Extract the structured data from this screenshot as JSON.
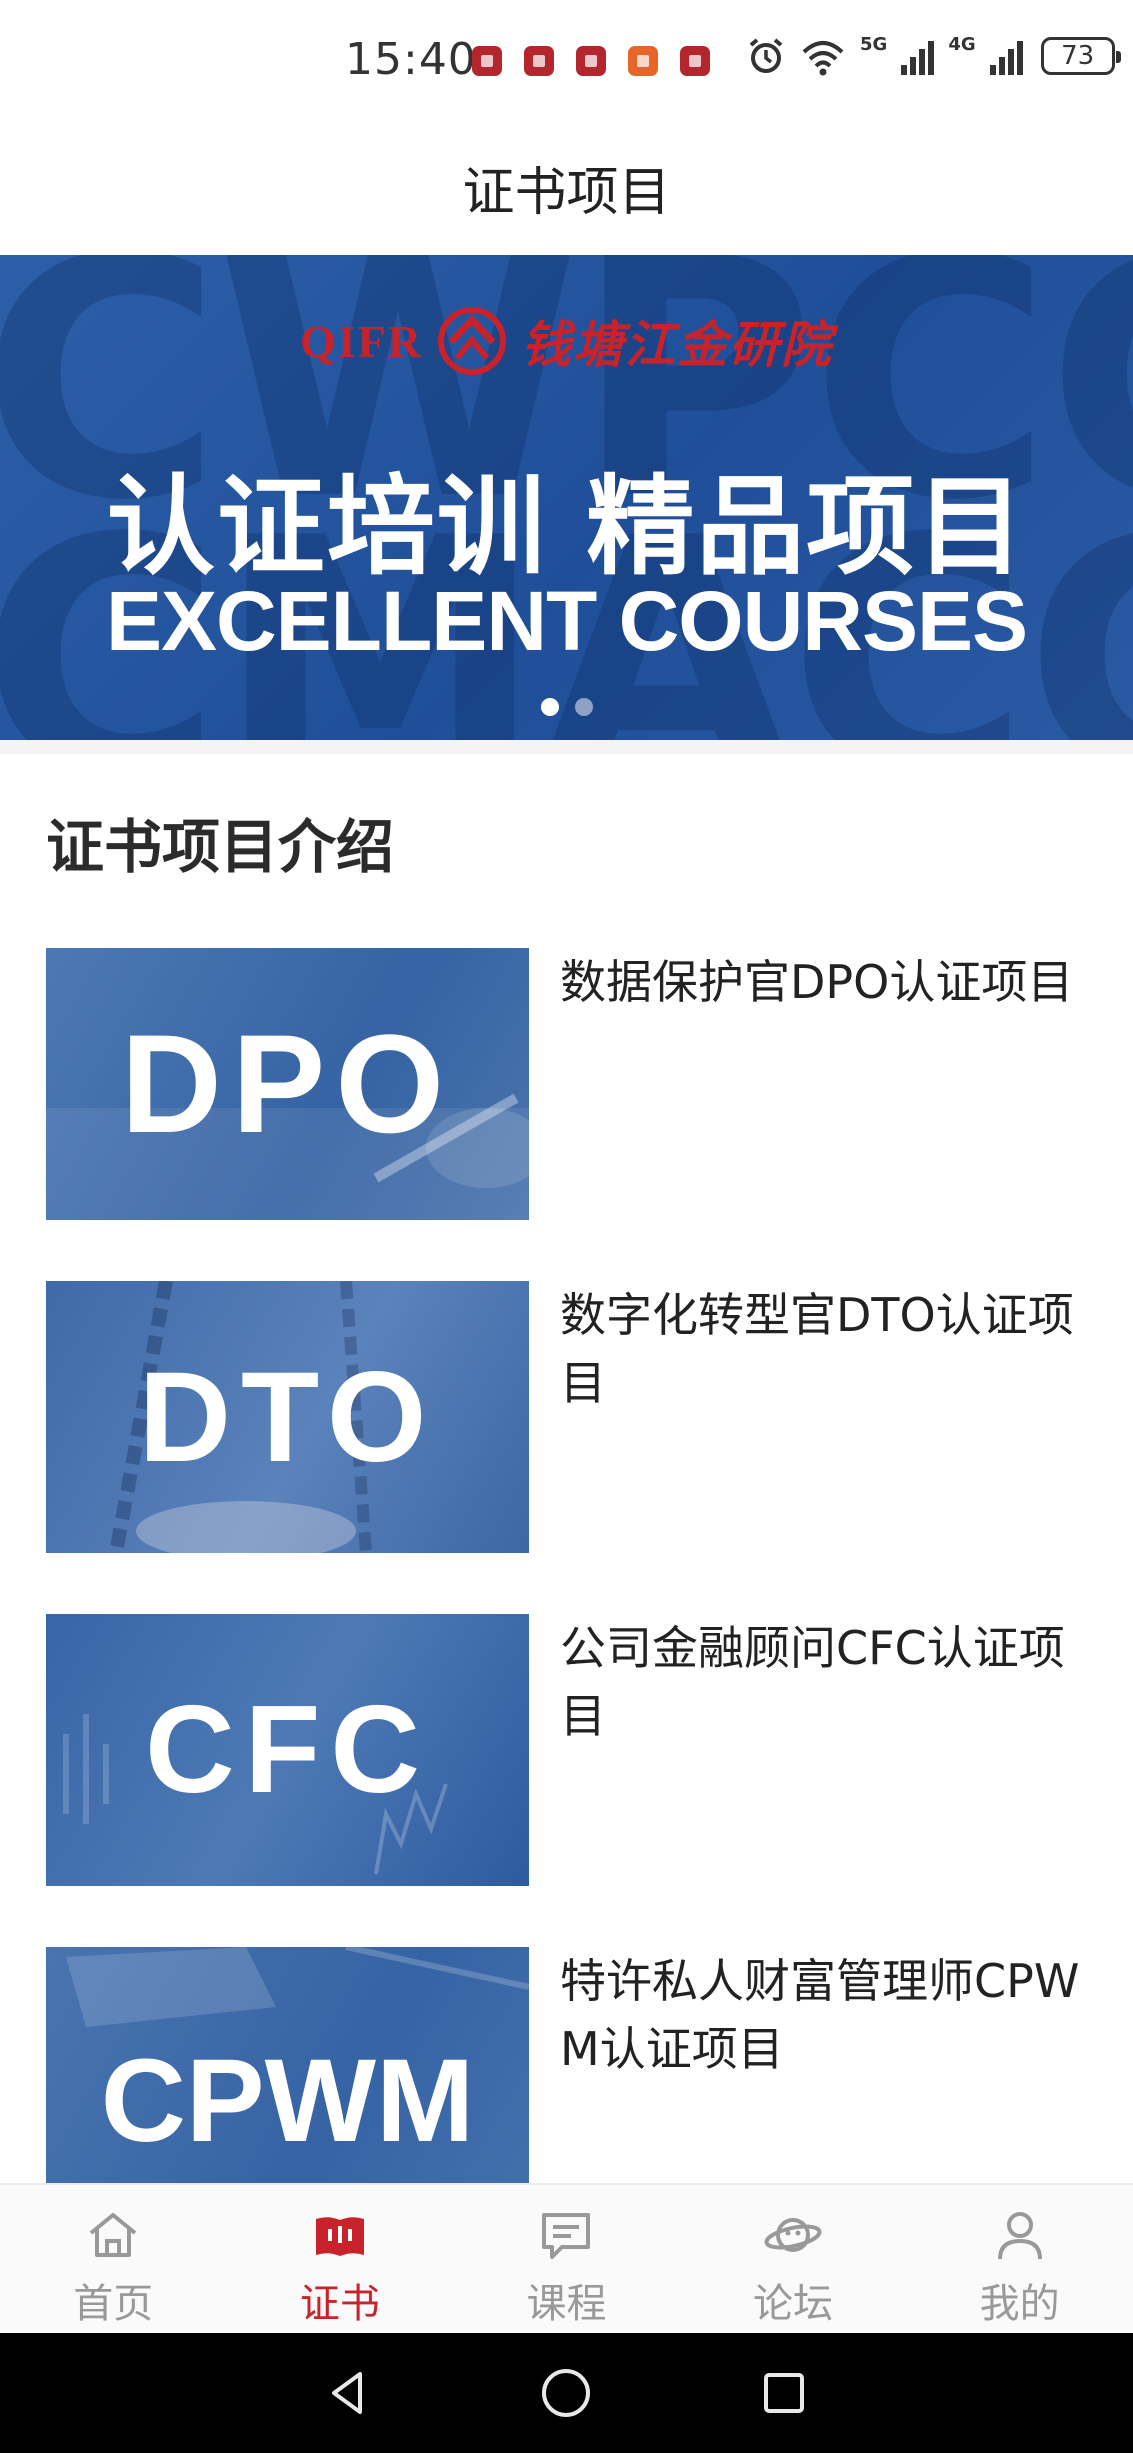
{
  "status_bar": {
    "time": "15:40",
    "network_5g": "5G",
    "network_4g": "4G",
    "battery": "73",
    "notification_icons": [
      "app-notification-icon",
      "app-notification-icon",
      "app-notification-icon",
      "app-notification-icon",
      "app-notification-icon"
    ]
  },
  "header": {
    "title": "证书项目"
  },
  "banner": {
    "logo_latin": "QIFR",
    "logo_cn": "钱塘江金研院",
    "background_letters_top": "CWPCCM",
    "background_letters_bottom": "CMACC",
    "title_cn": "认证培训 精品项目",
    "title_en": "EXCELLENT COURSES",
    "slide_count": 2,
    "active_slide": 0,
    "colors": {
      "background": "#2555a0",
      "logo_red": "#c8222a"
    }
  },
  "section": {
    "title": "证书项目介绍"
  },
  "courses": [
    {
      "thumb_text": "DPO",
      "name": "数据保护官DPO认证项目"
    },
    {
      "thumb_text": "DTO",
      "name": "数字化转型官DTO认证项目"
    },
    {
      "thumb_text": "CFC",
      "name": "公司金融顾问CFC认证项目"
    },
    {
      "thumb_text": "CPWM",
      "name": "特许私人财富管理师CPWM认证项目"
    }
  ],
  "tab_bar": {
    "active_index": 1,
    "active_color": "#c8222a",
    "tabs": [
      {
        "label": "首页",
        "icon": "home-icon"
      },
      {
        "label": "证书",
        "icon": "certificate-book-icon"
      },
      {
        "label": "课程",
        "icon": "course-message-icon"
      },
      {
        "label": "论坛",
        "icon": "forum-planet-icon"
      },
      {
        "label": "我的",
        "icon": "profile-person-icon"
      }
    ]
  },
  "nav_bar": {
    "buttons": [
      "back-icon",
      "home-circle-icon",
      "recents-square-icon"
    ]
  }
}
